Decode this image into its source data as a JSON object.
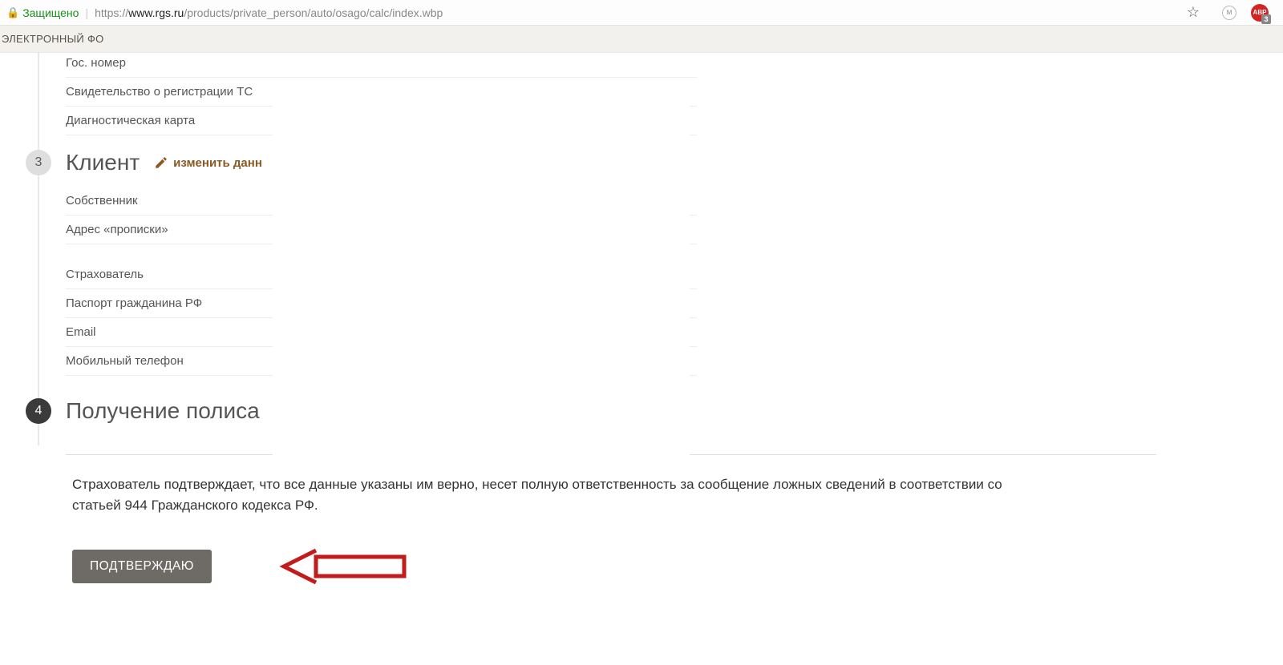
{
  "browser": {
    "secure_label": "Защищено",
    "url_prefix": "https://",
    "url_host": "www.rgs.ru",
    "url_path": "/products/private_person/auto/osago/calc/index.wbp",
    "abp_badge": "3",
    "ext_m": "м"
  },
  "bookmark_bar": {
    "item": "ЭЛЕКТРОННЫЙ ФО"
  },
  "section_vehicle": {
    "rows": [
      "Гос. номер",
      "Свидетельство о регистрации ТС",
      "Диагностическая карта"
    ]
  },
  "step3": {
    "num": "3",
    "title": "Клиент",
    "edit": "изменить данн",
    "rows_a": [
      "Собственник",
      "Адрес «прописки»"
    ],
    "rows_b": [
      "Страхователь",
      "Паспорт гражданина РФ",
      "Email",
      "Мобильный телефон"
    ]
  },
  "step4": {
    "num": "4",
    "title": "Получение полиса",
    "legal": "Страхователь подтверждает, что все данные указаны им верно, несет полную ответственность за сообщение ложных сведений в соответствии со статьей 944 Гражданского кодекса РФ.",
    "confirm": "ПОДТВЕРЖДАЮ"
  }
}
